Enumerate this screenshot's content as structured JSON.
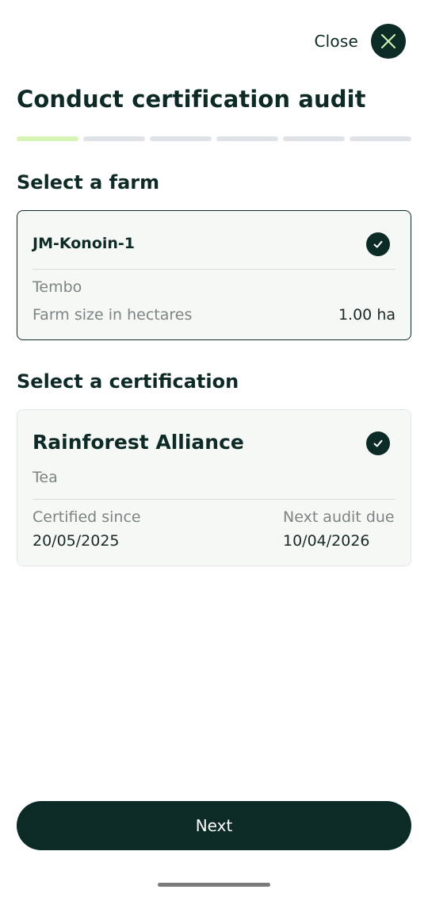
{
  "header": {
    "close_label": "Close",
    "title": "Conduct certification audit"
  },
  "progress": {
    "total_steps": 6,
    "current_step": 1
  },
  "farm_section": {
    "title": "Select a farm",
    "farm": {
      "name": "JM-Konoin-1",
      "location": "Tembo",
      "size_label": "Farm size in hectares",
      "size_value": "1.00 ha",
      "selected": true
    }
  },
  "certification_section": {
    "title": "Select a certification",
    "certification": {
      "name": "Rainforest Alliance",
      "crop": "Tea",
      "certified_since_label": "Certified since",
      "certified_since_value": "20/05/2025",
      "next_audit_label": "Next audit due",
      "next_audit_value": "10/04/2026",
      "selected": true
    }
  },
  "footer": {
    "next_label": "Next"
  },
  "colors": {
    "primary": "#0c2b26",
    "progress_active": "#d6f5b4",
    "progress_inactive": "#dfe3e8",
    "card_bg": "#f6f8f6"
  }
}
